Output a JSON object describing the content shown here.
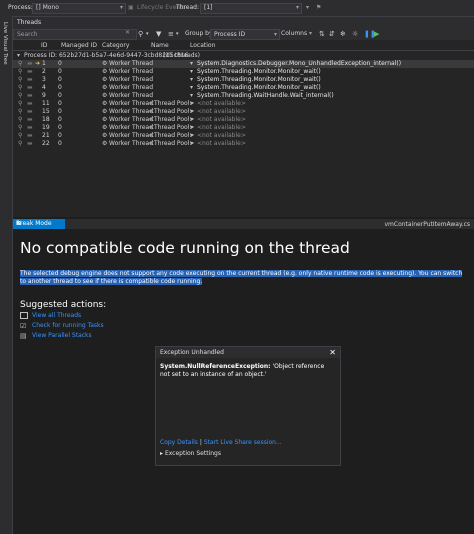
{
  "toolbar": {
    "process_label": "Process:",
    "process_value": "[] Mono",
    "lifecycle_label": "Lifecycle Events",
    "thread_label": "Thread:",
    "thread_value": "[1]"
  },
  "sidebar": {
    "live_visual_tree": "Live Visual Tree"
  },
  "threads_panel": {
    "title": "Threads",
    "search_placeholder": "Search",
    "group_by_label": "Group by:",
    "group_by_value": "Process ID",
    "columns_label": "Columns",
    "columns": [
      "ID",
      "Managed ID",
      "Category",
      "Name",
      "Location"
    ],
    "process_row": {
      "label": "Process ID: 652b27d1-b5a7-4e6d-9447-3cbd82d5c816",
      "count": "(11 threads)"
    },
    "rows": [
      {
        "id": "1",
        "managed_id": "0",
        "category": "Worker Thread",
        "name": "",
        "location": "System.Diagnostics.Debugger.Mono_UnhandledException_internal()",
        "current": true
      },
      {
        "id": "2",
        "managed_id": "0",
        "category": "Worker Thread",
        "name": "",
        "location": "System.Threading.Monitor.Monitor_wait()"
      },
      {
        "id": "3",
        "managed_id": "0",
        "category": "Worker Thread",
        "name": "",
        "location": "System.Threading.Monitor.Monitor_wait()"
      },
      {
        "id": "4",
        "managed_id": "0",
        "category": "Worker Thread",
        "name": "",
        "location": "System.Threading.Monitor.Monitor_wait()"
      },
      {
        "id": "9",
        "managed_id": "0",
        "category": "Worker Thread",
        "name": "",
        "location": "System.Threading.WaitHandle.Wait_internal()"
      },
      {
        "id": "11",
        "managed_id": "0",
        "category": "Worker Thread",
        "name": "<Thread Pool>",
        "location": "<not available>"
      },
      {
        "id": "15",
        "managed_id": "0",
        "category": "Worker Thread",
        "name": "<Thread Pool>",
        "location": "<not available>"
      },
      {
        "id": "18",
        "managed_id": "0",
        "category": "Worker Thread",
        "name": "<Thread Pool>",
        "location": "<not available>"
      },
      {
        "id": "19",
        "managed_id": "0",
        "category": "Worker Thread",
        "name": "<Thread Pool>",
        "location": "<not available>"
      },
      {
        "id": "21",
        "managed_id": "0",
        "category": "Worker Thread",
        "name": "<Thread Pool>",
        "location": "<not available>"
      },
      {
        "id": "22",
        "managed_id": "0",
        "category": "Worker Thread",
        "name": "<Thread Pool>",
        "location": "<not available>"
      }
    ]
  },
  "break_mode": {
    "tab_label": "Break Mode",
    "file_tab": "vmContainerPutItemAway.cs",
    "title": "No compatible code running on the thread",
    "message": "The selected debug engine does not support any code executing on the current thread (e.g. only native runtime code is executing). You can switch to another thread to see if there is compatible code running.",
    "suggested_title": "Suggested actions:",
    "actions": [
      "View all Threads",
      "Check for running Tasks",
      "View Parallel Stacks"
    ]
  },
  "exception": {
    "title": "Exception Unhandled",
    "type": "System.NullReferenceException:",
    "message": "'Object reference not set to an instance of an object.'",
    "link_copy": "Copy Details",
    "link_separator": "|",
    "link_liveshare": "Start Live Share session...",
    "settings": "Exception Settings"
  },
  "colors": {
    "accent": "#007acc",
    "link": "#3794ff",
    "selection": "#2762b3",
    "background": "#1e1e1e"
  }
}
